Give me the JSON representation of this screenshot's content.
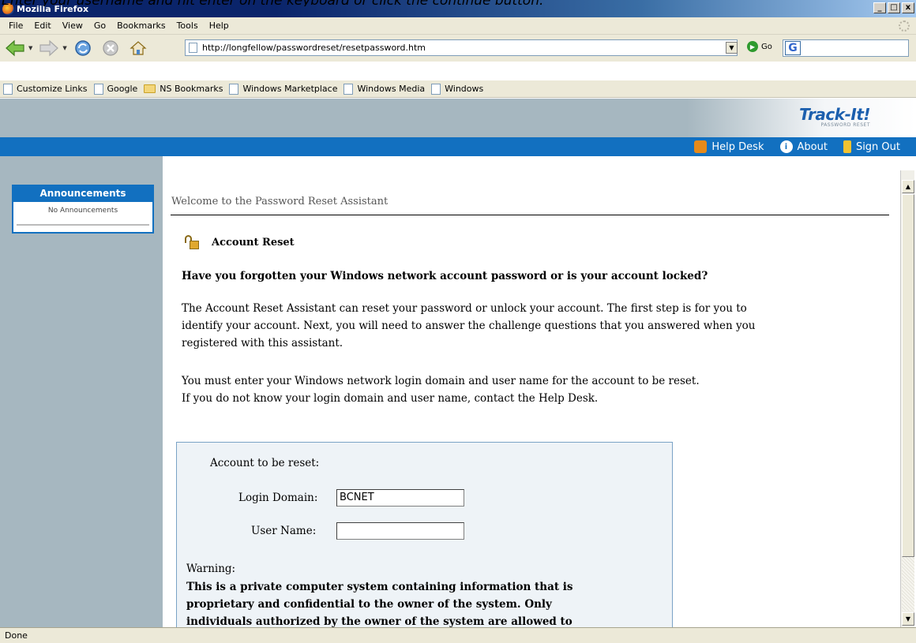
{
  "caption": "Enter your username and hit enter on the keyboard or click the continue button.",
  "window": {
    "title": "Mozilla Firefox",
    "buttons": [
      "_",
      "□",
      "x"
    ]
  },
  "menu": [
    "File",
    "Edit",
    "View",
    "Go",
    "Bookmarks",
    "Tools",
    "Help"
  ],
  "nav": {
    "url": "http://longfellow/passwordreset/resetpassword.htm",
    "go_label": "Go",
    "search_logo": "G"
  },
  "bookmarks": [
    {
      "label": "Customize Links",
      "type": "page"
    },
    {
      "label": "Google",
      "type": "page"
    },
    {
      "label": "NS Bookmarks",
      "type": "folder"
    },
    {
      "label": "Windows Marketplace",
      "type": "page"
    },
    {
      "label": "Windows Media",
      "type": "page"
    },
    {
      "label": "Windows",
      "type": "page"
    }
  ],
  "brand": {
    "name": "Track-It!",
    "subtitle": "PASSWORD RESET",
    "accent": "#1270c0"
  },
  "toplinks": {
    "help_desk": "Help Desk",
    "about": "About",
    "sign_out": "Sign Out"
  },
  "sidebar": {
    "announcements_title": "Announcements",
    "announcements_body": "No Announcements"
  },
  "content": {
    "welcome": "Welcome to the Password Reset Assistant",
    "section_title": "Account Reset",
    "question": "Have you forgotten your Windows network account password or is your account locked?",
    "para1_line1": "The Account Reset Assistant can reset your password or unlock your account. The first step is for you to",
    "para1_line2": "identify your account. Next, you will need to answer the challenge questions that you answered when you",
    "para1_line3": "registered with this assistant.",
    "para2_line1": "You must enter your Windows network login domain and user name for the account to be reset.",
    "para2_line2": "If you do not know your login domain and user name, contact the Help Desk."
  },
  "form": {
    "account_label": "Account to be reset:",
    "domain_label": "Login Domain:",
    "domain_value": "BCNET",
    "user_label": "User Name:",
    "user_value": "",
    "warning_title": "Warning:",
    "warning_line1": "This is a private computer system containing information that is",
    "warning_line2": "proprietary and confidential to the owner of the system. Only",
    "warning_line3": "individuals authorized by the owner of the system are allowed to"
  },
  "status": "Done"
}
